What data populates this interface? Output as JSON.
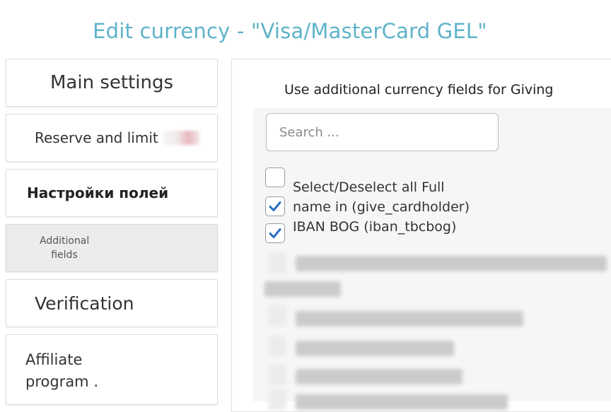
{
  "page": {
    "title": "Edit currency - \"Visa/MasterCard GEL\""
  },
  "sidebar": {
    "items": [
      {
        "label": "Main settings"
      },
      {
        "label": "Reserve and limit"
      },
      {
        "label": "Настройки полей"
      },
      {
        "label_line1": "Additional",
        "label_line2": "fields",
        "active": true
      },
      {
        "label": "Verification"
      },
      {
        "label_line1": "Affiliate",
        "label_line2": "program ."
      }
    ]
  },
  "main": {
    "heading": "Use additional currency fields for Giving",
    "search": {
      "placeholder": "Search ...",
      "value": ""
    },
    "options": [
      {
        "label_line1": "Select/Deselect all Full",
        "label_line2": "name in (give_cardholder)",
        "select_all_checked": false,
        "checked": true
      },
      {
        "label": "IBAN BOG (iban_tbcbog)",
        "checked": true
      }
    ]
  },
  "colors": {
    "title": "#5fb3c9",
    "checkmark": "#2a6fc4",
    "active_tab_bg": "#ececec"
  },
  "icons": {
    "checkbox_checked": "checkmark-icon"
  }
}
